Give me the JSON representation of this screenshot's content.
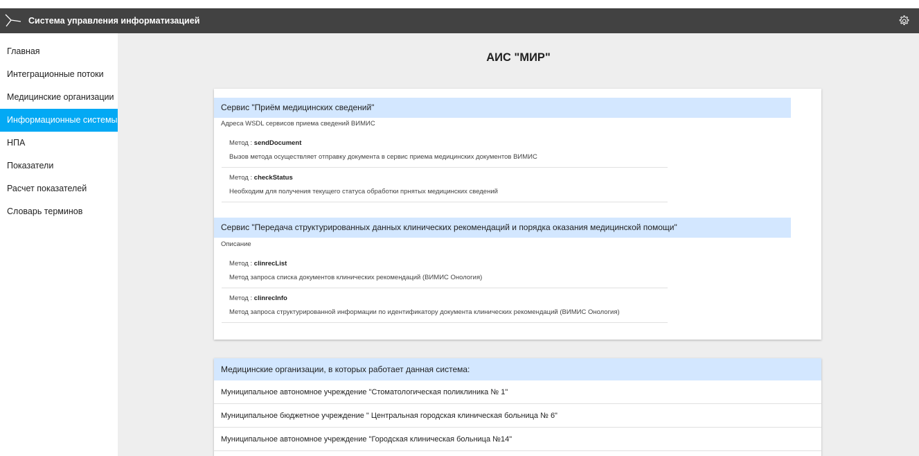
{
  "header": {
    "app_title": "Система управления информатизацией",
    "logo_icon": "branch-logo-icon",
    "settings_icon": "gear-icon"
  },
  "sidebar": {
    "items": [
      {
        "label": "Главная",
        "active": false
      },
      {
        "label": "Интеграционные потоки",
        "active": false
      },
      {
        "label": "Медицинские организации",
        "active": false
      },
      {
        "label": "Информационные системы",
        "active": true
      },
      {
        "label": "НПА",
        "active": false
      },
      {
        "label": "Показатели",
        "active": false
      },
      {
        "label": "Расчет показателей",
        "active": false
      },
      {
        "label": "Словарь терминов",
        "active": false
      }
    ],
    "active_color": "#03a9f4"
  },
  "main": {
    "title": "АИС \"МИР\"",
    "method_prefix": "Метод : ",
    "services": [
      {
        "header": "Сервис \"Приём медицинских сведений\"",
        "description": "Адреса WSDL сервисов приема сведений ВИМИС",
        "methods": [
          {
            "name": "sendDocument",
            "description": "Вызов метода осуществляет отправку документа в сервис приема медицинских документов ВИМИС"
          },
          {
            "name": "checkStatus",
            "description": "Необходим для получения текущего статуса обработки прнятых медицинских сведений"
          }
        ]
      },
      {
        "header": "Сервис \"Передача структурированных данных клинических рекомендаций и порядка оказания медицинской помощи\"",
        "description": "Описание",
        "methods": [
          {
            "name": "clinrecList",
            "description": "Метод запроса списка документов клинических рекомендаций (ВИМИС Онология)"
          },
          {
            "name": "clinrecInfo",
            "description": "Метод запроса структурированной информации по идентификатору документа клинических рекомендаций (ВИМИС Онология)"
          }
        ]
      }
    ],
    "organizations": {
      "header": "Медицинские организации, в которых работает данная система:",
      "items": [
        "Муниципальное автономное учреждение \"Стоматологическая поликлиника № 1\"",
        "Муниципальное бюджетное учреждение \" Центральная городская клиническая больница № 6\"",
        "Муниципальное автономное учреждение \"Городская клиническая больница №14\""
      ]
    }
  },
  "colors": {
    "topbar": "#424242",
    "section_header": "#d3e7ff",
    "main_bg": "#eeeeee"
  }
}
